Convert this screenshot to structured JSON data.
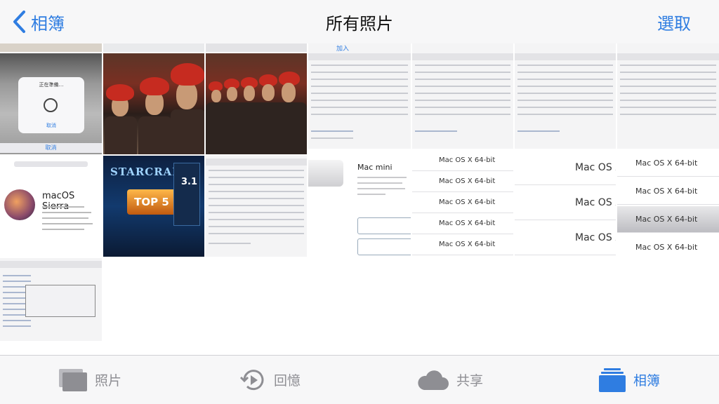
{
  "nav": {
    "back_label": "相簿",
    "title": "所有照片",
    "select_label": "選取"
  },
  "thumbs": {
    "preparing_text": "正在準備…",
    "preparing_cancel": "取消",
    "preparing_cancel_bar": "取消",
    "sc2_logo": "STARCRAFT",
    "sc2_badge": "TOP 5",
    "sc2_version": "3.1",
    "mac_os_name": "macOS Sierra",
    "mac_mini_title": "Mac mini",
    "add_label": "加入",
    "os_item": "Mac OS X 64-bit",
    "os_item_big": "Mac OS X"
  },
  "tabbar": {
    "photos": "照片",
    "memories": "回憶",
    "shared": "共享",
    "albums": "相簿"
  },
  "colors": {
    "accent": "#2f7de1",
    "inactive": "#8e8e93"
  }
}
